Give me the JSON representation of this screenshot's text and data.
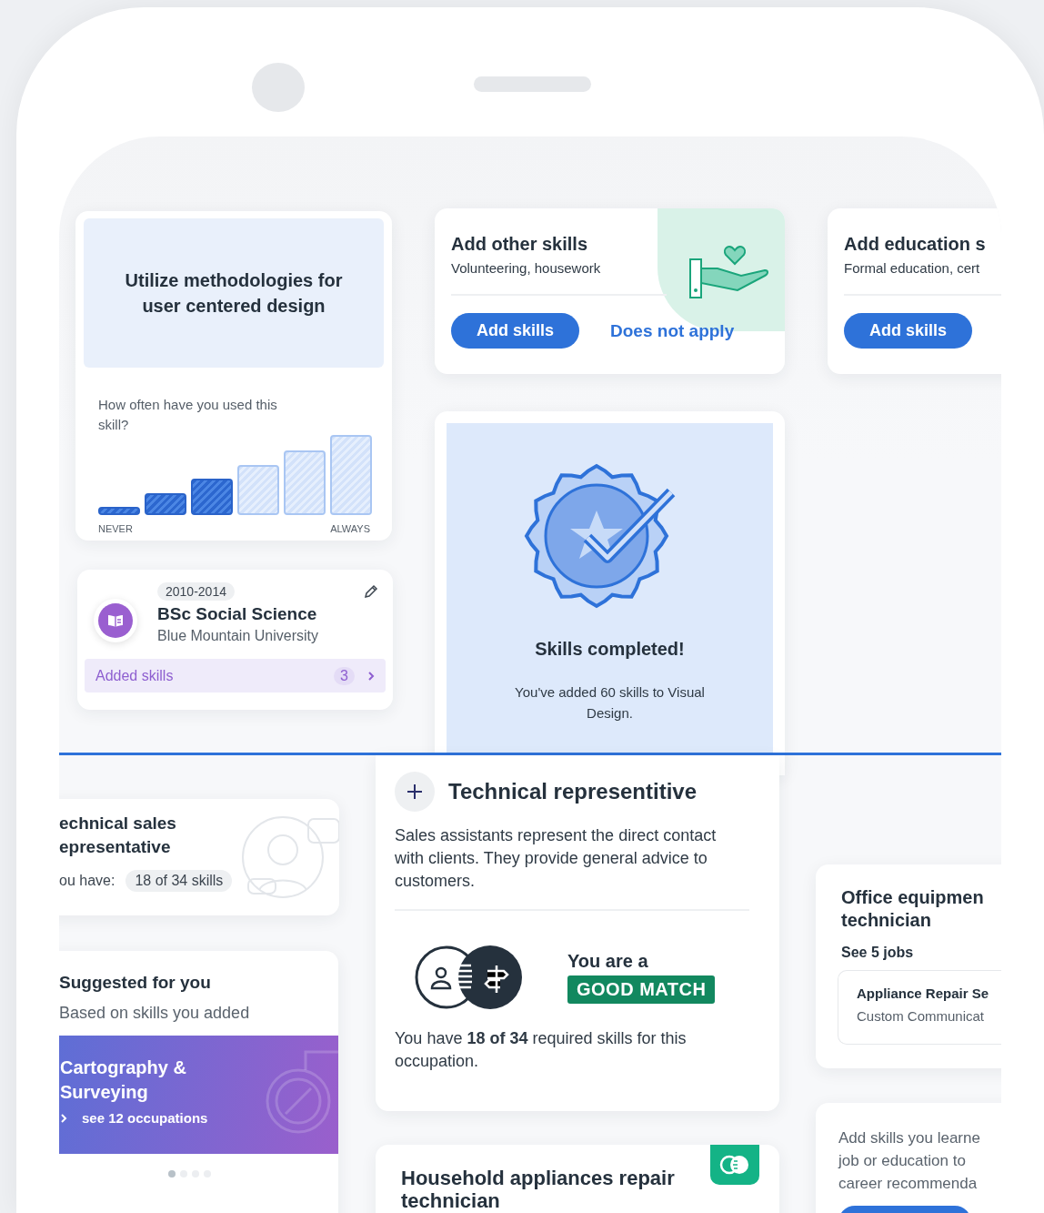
{
  "skill_card": {
    "title": "Utilize methodologies for user centered design",
    "question": "How often have you used this skill?",
    "scale": [
      {
        "filled": true
      },
      {
        "filled": true
      },
      {
        "filled": true
      },
      {
        "filled": false
      },
      {
        "filled": false
      },
      {
        "filled": false
      }
    ],
    "min_label": "NEVER",
    "max_label": "ALWAYS"
  },
  "education_card": {
    "years": "2010-2014",
    "degree": "BSc Social Science",
    "school": "Blue Mountain University",
    "added_skills": {
      "label": "Added skills",
      "count": "3"
    }
  },
  "prompt_cards": [
    {
      "title": "Add other skills",
      "subtitle": "Volunteering, housework",
      "button": "Add skills",
      "link": "Does not apply"
    },
    {
      "title": "Add education s",
      "subtitle": "Formal education, cert",
      "button": "Add skills"
    }
  ],
  "completion_card": {
    "title": "Skills completed!",
    "message": "You've added 60 skills to Visual Design."
  },
  "occupation_card": {
    "title_lines": [
      "echnical sales",
      "epresentative"
    ],
    "skills_label": "ou have:",
    "skills_count": "18 of 34 skills"
  },
  "suggested_card": {
    "title": "Suggested for you",
    "subtitle": "Based on skills you added",
    "category": {
      "title": "Cartography & Surveying",
      "link": "see 12 occupations"
    },
    "pages": [
      {
        "selected": true
      },
      {
        "selected": false
      },
      {
        "selected": false
      },
      {
        "selected": false
      }
    ]
  },
  "match_card": {
    "title": "Technical representitive",
    "description": "Sales assistants represent the direct contact with clients. They provide general advice to customers.",
    "match_intro": "You are a",
    "match_badge": "GOOD MATCH",
    "summary": "You have **18 of 34** required skills for this occupation."
  },
  "household_card": {
    "title": "Household appliances repair technician"
  },
  "office_card": {
    "title_lines": [
      "Office equipmen",
      "technician"
    ],
    "jobs_link": "See 5 jobs",
    "job": {
      "title": "Appliance Repair Se",
      "company": "Custom Communicat"
    }
  },
  "recommend_card": {
    "lines": [
      "Add skills you learne",
      "job or education to",
      "career recommenda"
    ]
  }
}
